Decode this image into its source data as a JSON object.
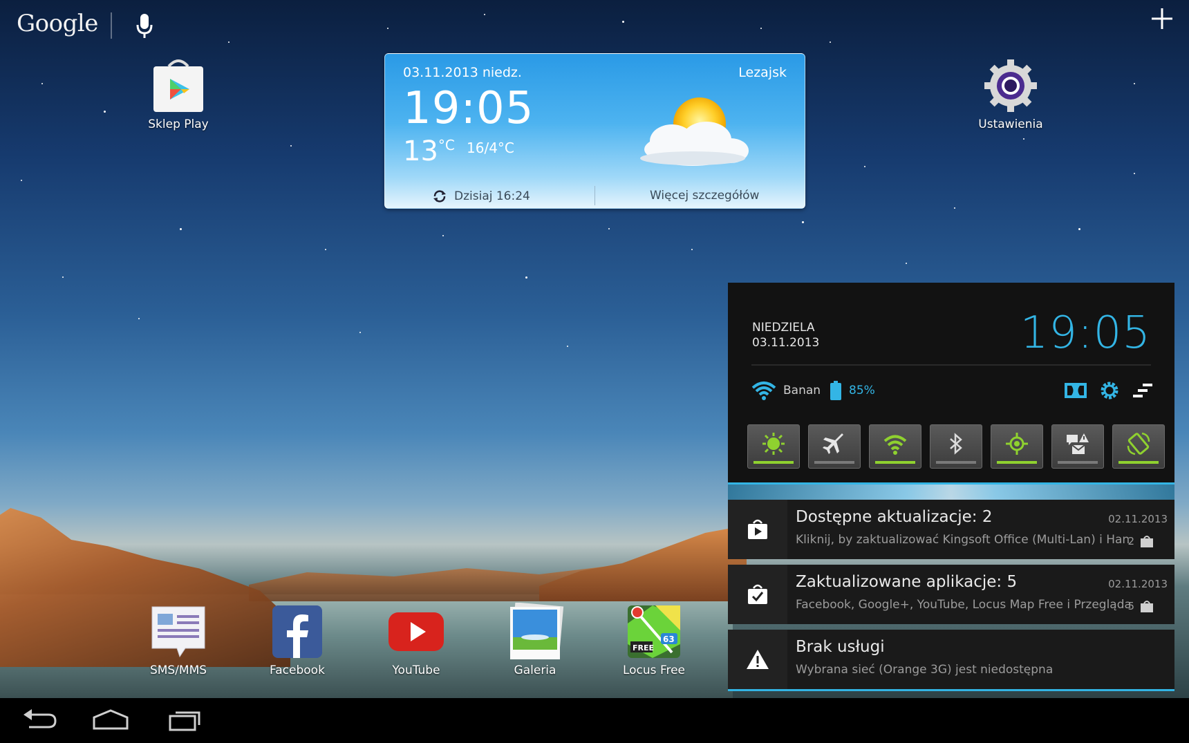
{
  "topbar": {
    "google_label": "Google"
  },
  "apps_top": [
    {
      "label": "Sklep Play"
    },
    {
      "label": "Ustawienia"
    }
  ],
  "weather": {
    "date": "03.11.2013  niedz.",
    "city": "Lezajsk",
    "time": "19:05",
    "temp": "13",
    "temp_unit": "°C",
    "range": "16/4°C",
    "refresh_label": "Dzisiaj 16:24",
    "more_label": "Więcej szczegółów"
  },
  "dock_apps": [
    {
      "label": "SMS/MMS"
    },
    {
      "label": "Facebook"
    },
    {
      "label": "YouTube"
    },
    {
      "label": "Galeria"
    },
    {
      "label": "Locus Free"
    }
  ],
  "panel": {
    "day_name": "NIEDZIELA",
    "day_date": "03.11.2013",
    "clock": "19:05",
    "wifi_name": "Banan",
    "battery": "85%",
    "toggles": [
      {
        "icon": "brightness-icon",
        "on": true
      },
      {
        "icon": "airplane-icon",
        "on": false
      },
      {
        "icon": "wifi-icon",
        "on": true
      },
      {
        "icon": "bluetooth-icon",
        "on": false
      },
      {
        "icon": "gps-icon",
        "on": true
      },
      {
        "icon": "notification-icon",
        "on": false
      },
      {
        "icon": "rotation-icon",
        "on": true
      }
    ],
    "accent": "#33b5e5",
    "toggle_on_color": "#8fd12f"
  },
  "notifications": [
    {
      "title": "Dostępne aktualizacje: 2",
      "text": "Kliknij, by zaktualizować Kingsoft Office (Multi-Lan) i Hangouts",
      "date": "02.11.2013",
      "count": "2"
    },
    {
      "title": "Zaktualizowane aplikacje: 5",
      "text": "Facebook, Google+, YouTube, Locus Map Free i Przeglądarka",
      "date": "02.11.2013",
      "count": "5"
    },
    {
      "title": "Brak usługi",
      "text": "Wybrana sieć (Orange  3G) jest niedostępna"
    }
  ]
}
